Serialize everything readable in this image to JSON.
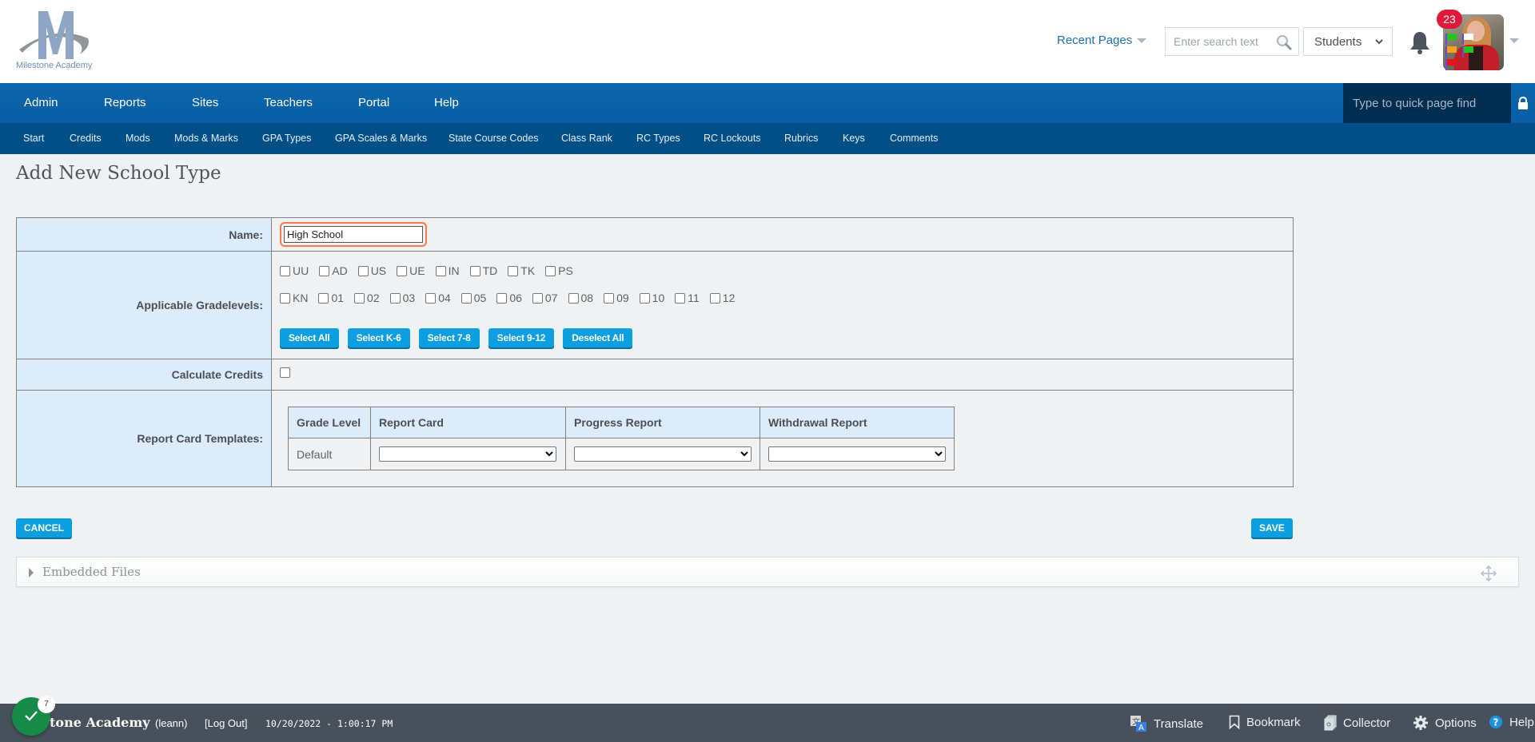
{
  "header": {
    "logo_text": "Milestone Academy",
    "recent_pages_label": "Recent Pages",
    "search_placeholder": "Enter search text",
    "search_scope": "Students",
    "notification_count": "23",
    "flag_colors": [
      "#22c71d",
      "#ffffff",
      "#f5a11c",
      "#22c71d",
      "#e8141c"
    ]
  },
  "main_nav": {
    "items": [
      {
        "label": "Admin"
      },
      {
        "label": "Reports"
      },
      {
        "label": "Sites"
      },
      {
        "label": "Teachers"
      },
      {
        "label": "Portal"
      },
      {
        "label": "Help"
      }
    ],
    "quick_find_placeholder": "Type to quick page find"
  },
  "sub_nav": {
    "items": [
      {
        "label": "Start"
      },
      {
        "label": "Credits"
      },
      {
        "label": "Mods"
      },
      {
        "label": "Mods & Marks"
      },
      {
        "label": "GPA Types"
      },
      {
        "label": "GPA Scales & Marks"
      },
      {
        "label": "State Course Codes"
      },
      {
        "label": "Class Rank"
      },
      {
        "label": "RC Types"
      },
      {
        "label": "RC Lockouts"
      },
      {
        "label": "Rubrics"
      },
      {
        "label": "Keys"
      },
      {
        "label": "Comments"
      }
    ]
  },
  "page": {
    "title": "Add New School Type",
    "form": {
      "name_label": "Name:",
      "name_value": "High School",
      "gradelevels_label": "Applicable Gradelevels:",
      "gradelevels_row1": [
        {
          "label": "UU",
          "checked": false
        },
        {
          "label": "AD",
          "checked": false
        },
        {
          "label": "US",
          "checked": false
        },
        {
          "label": "UE",
          "checked": false
        },
        {
          "label": "IN",
          "checked": false
        },
        {
          "label": "TD",
          "checked": false
        },
        {
          "label": "TK",
          "checked": false
        },
        {
          "label": "PS",
          "checked": false
        }
      ],
      "gradelevels_row2": [
        {
          "label": "KN",
          "checked": false
        },
        {
          "label": "01",
          "checked": false
        },
        {
          "label": "02",
          "checked": false
        },
        {
          "label": "03",
          "checked": false
        },
        {
          "label": "04",
          "checked": false
        },
        {
          "label": "05",
          "checked": false
        },
        {
          "label": "06",
          "checked": false
        },
        {
          "label": "07",
          "checked": false
        },
        {
          "label": "08",
          "checked": false
        },
        {
          "label": "09",
          "checked": false
        },
        {
          "label": "10",
          "checked": false
        },
        {
          "label": "11",
          "checked": false
        },
        {
          "label": "12",
          "checked": false
        }
      ],
      "select_buttons": {
        "select_all": "Select All",
        "select_k6": "Select K-6",
        "select_78": "Select 7-8",
        "select_912": "Select 9-12",
        "deselect_all": "Deselect All"
      },
      "calculate_credits_label": "Calculate Credits",
      "calculate_credits_checked": false,
      "templates_label": "Report Card Templates:",
      "templates_table": {
        "headers": [
          "Grade Level",
          "Report Card",
          "Progress Report",
          "Withdrawal Report"
        ],
        "rows": [
          {
            "grade_level": "Default",
            "report_card": "",
            "progress_report": "",
            "withdrawal_report": ""
          }
        ]
      }
    },
    "cancel_label": "CANCEL",
    "save_label": "SAVE",
    "embedded_files_label": "Embedded Files"
  },
  "footer": {
    "school_name": "tone Academy",
    "user": "(leann)",
    "logout_label": "[Log Out]",
    "datetime": "10/20/2022 - 1:00:17 PM",
    "check_count": "7",
    "items": [
      {
        "label": "Translate"
      },
      {
        "label": "Bookmark"
      },
      {
        "label": "Collector"
      },
      {
        "label": "Options"
      },
      {
        "label": "Help"
      }
    ]
  }
}
